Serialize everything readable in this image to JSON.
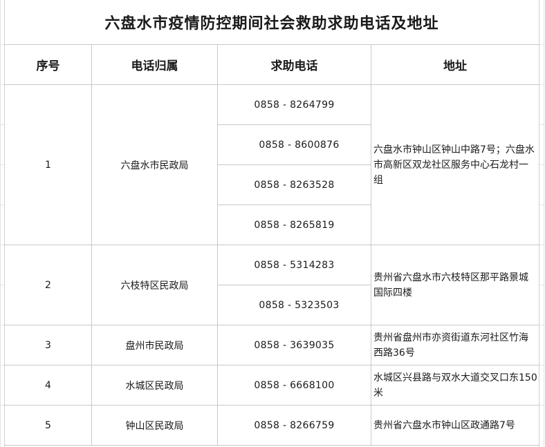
{
  "title": "六盘水市疫情防控期间社会救助求助电话及地址",
  "headers": {
    "index": "序号",
    "owner": "电话归属",
    "phone": "求助电话",
    "address": "地址"
  },
  "rows": [
    {
      "index": "1",
      "owner": "六盘水市民政局",
      "phones": [
        "0858 - 8264799",
        "0858 - 8600876",
        "0858 - 8263528",
        "0858 - 8265819"
      ],
      "address": "六盘水市钟山区钟山中路7号；六盘水市高新区双龙社区服务中心石龙村一组"
    },
    {
      "index": "2",
      "owner": "六枝特区民政局",
      "phones": [
        "0858 - 5314283",
        "0858 - 5323503"
      ],
      "address": "贵州省六盘水市六枝特区那平路景城国际四楼"
    },
    {
      "index": "3",
      "owner": "盘州市民政局",
      "phones": [
        "0858 - 3639035"
      ],
      "address": "贵州省盘州市亦资街道东河社区竹海西路36号"
    },
    {
      "index": "4",
      "owner": "水城区民政局",
      "phones": [
        "0858 - 6668100"
      ],
      "address": "水城区兴县路与双水大道交叉口东150米"
    },
    {
      "index": "5",
      "owner": "钟山区民政局",
      "phones": [
        "0858 - 8266759"
      ],
      "address": "贵州省六盘水市钟山区政通路7号"
    }
  ]
}
